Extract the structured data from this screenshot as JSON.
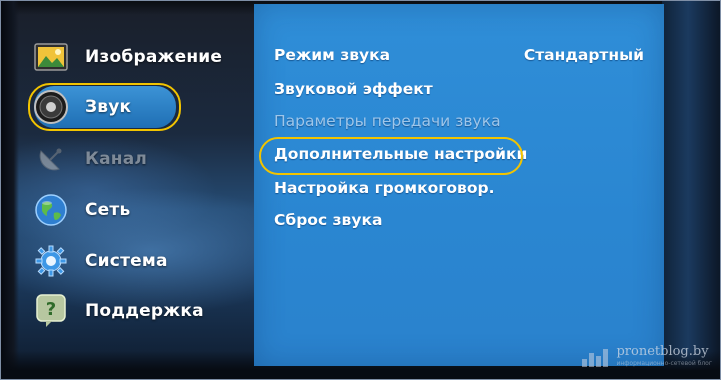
{
  "side_menu": {
    "items": [
      {
        "label": "Изображение",
        "icon": "picture-icon",
        "state": "normal"
      },
      {
        "label": "Звук",
        "icon": "speaker-icon",
        "state": "selected"
      },
      {
        "label": "Канал",
        "icon": "satellite-dish-icon",
        "state": "disabled"
      },
      {
        "label": "Сеть",
        "icon": "globe-icon",
        "state": "normal"
      },
      {
        "label": "Система",
        "icon": "gear-icon",
        "state": "normal"
      },
      {
        "label": "Поддержка",
        "icon": "help-icon",
        "state": "normal"
      }
    ]
  },
  "sound_menu": {
    "rows": [
      {
        "label": "Режим звука",
        "value": "Стандартный",
        "state": "normal"
      },
      {
        "label": "Звуковой эффект",
        "value": "",
        "state": "normal"
      },
      {
        "label": "Параметры передачи звука",
        "value": "",
        "state": "disabled"
      },
      {
        "label": "Дополнительные настройки",
        "value": "",
        "state": "highlighted"
      },
      {
        "label": "Настройка громкоговор.",
        "value": "",
        "state": "normal"
      },
      {
        "label": "Сброс звука",
        "value": "",
        "state": "normal"
      }
    ]
  },
  "watermark": {
    "text": "pronetblog.by",
    "subtext": "информационно-сетевой блог"
  },
  "colors": {
    "panel_blue": "#2f8ed8",
    "selection_blue": "#2a7fc4",
    "highlight_yellow": "#f2c400",
    "text_white": "#ffffff",
    "disabled_text": "#9ec6ea"
  }
}
